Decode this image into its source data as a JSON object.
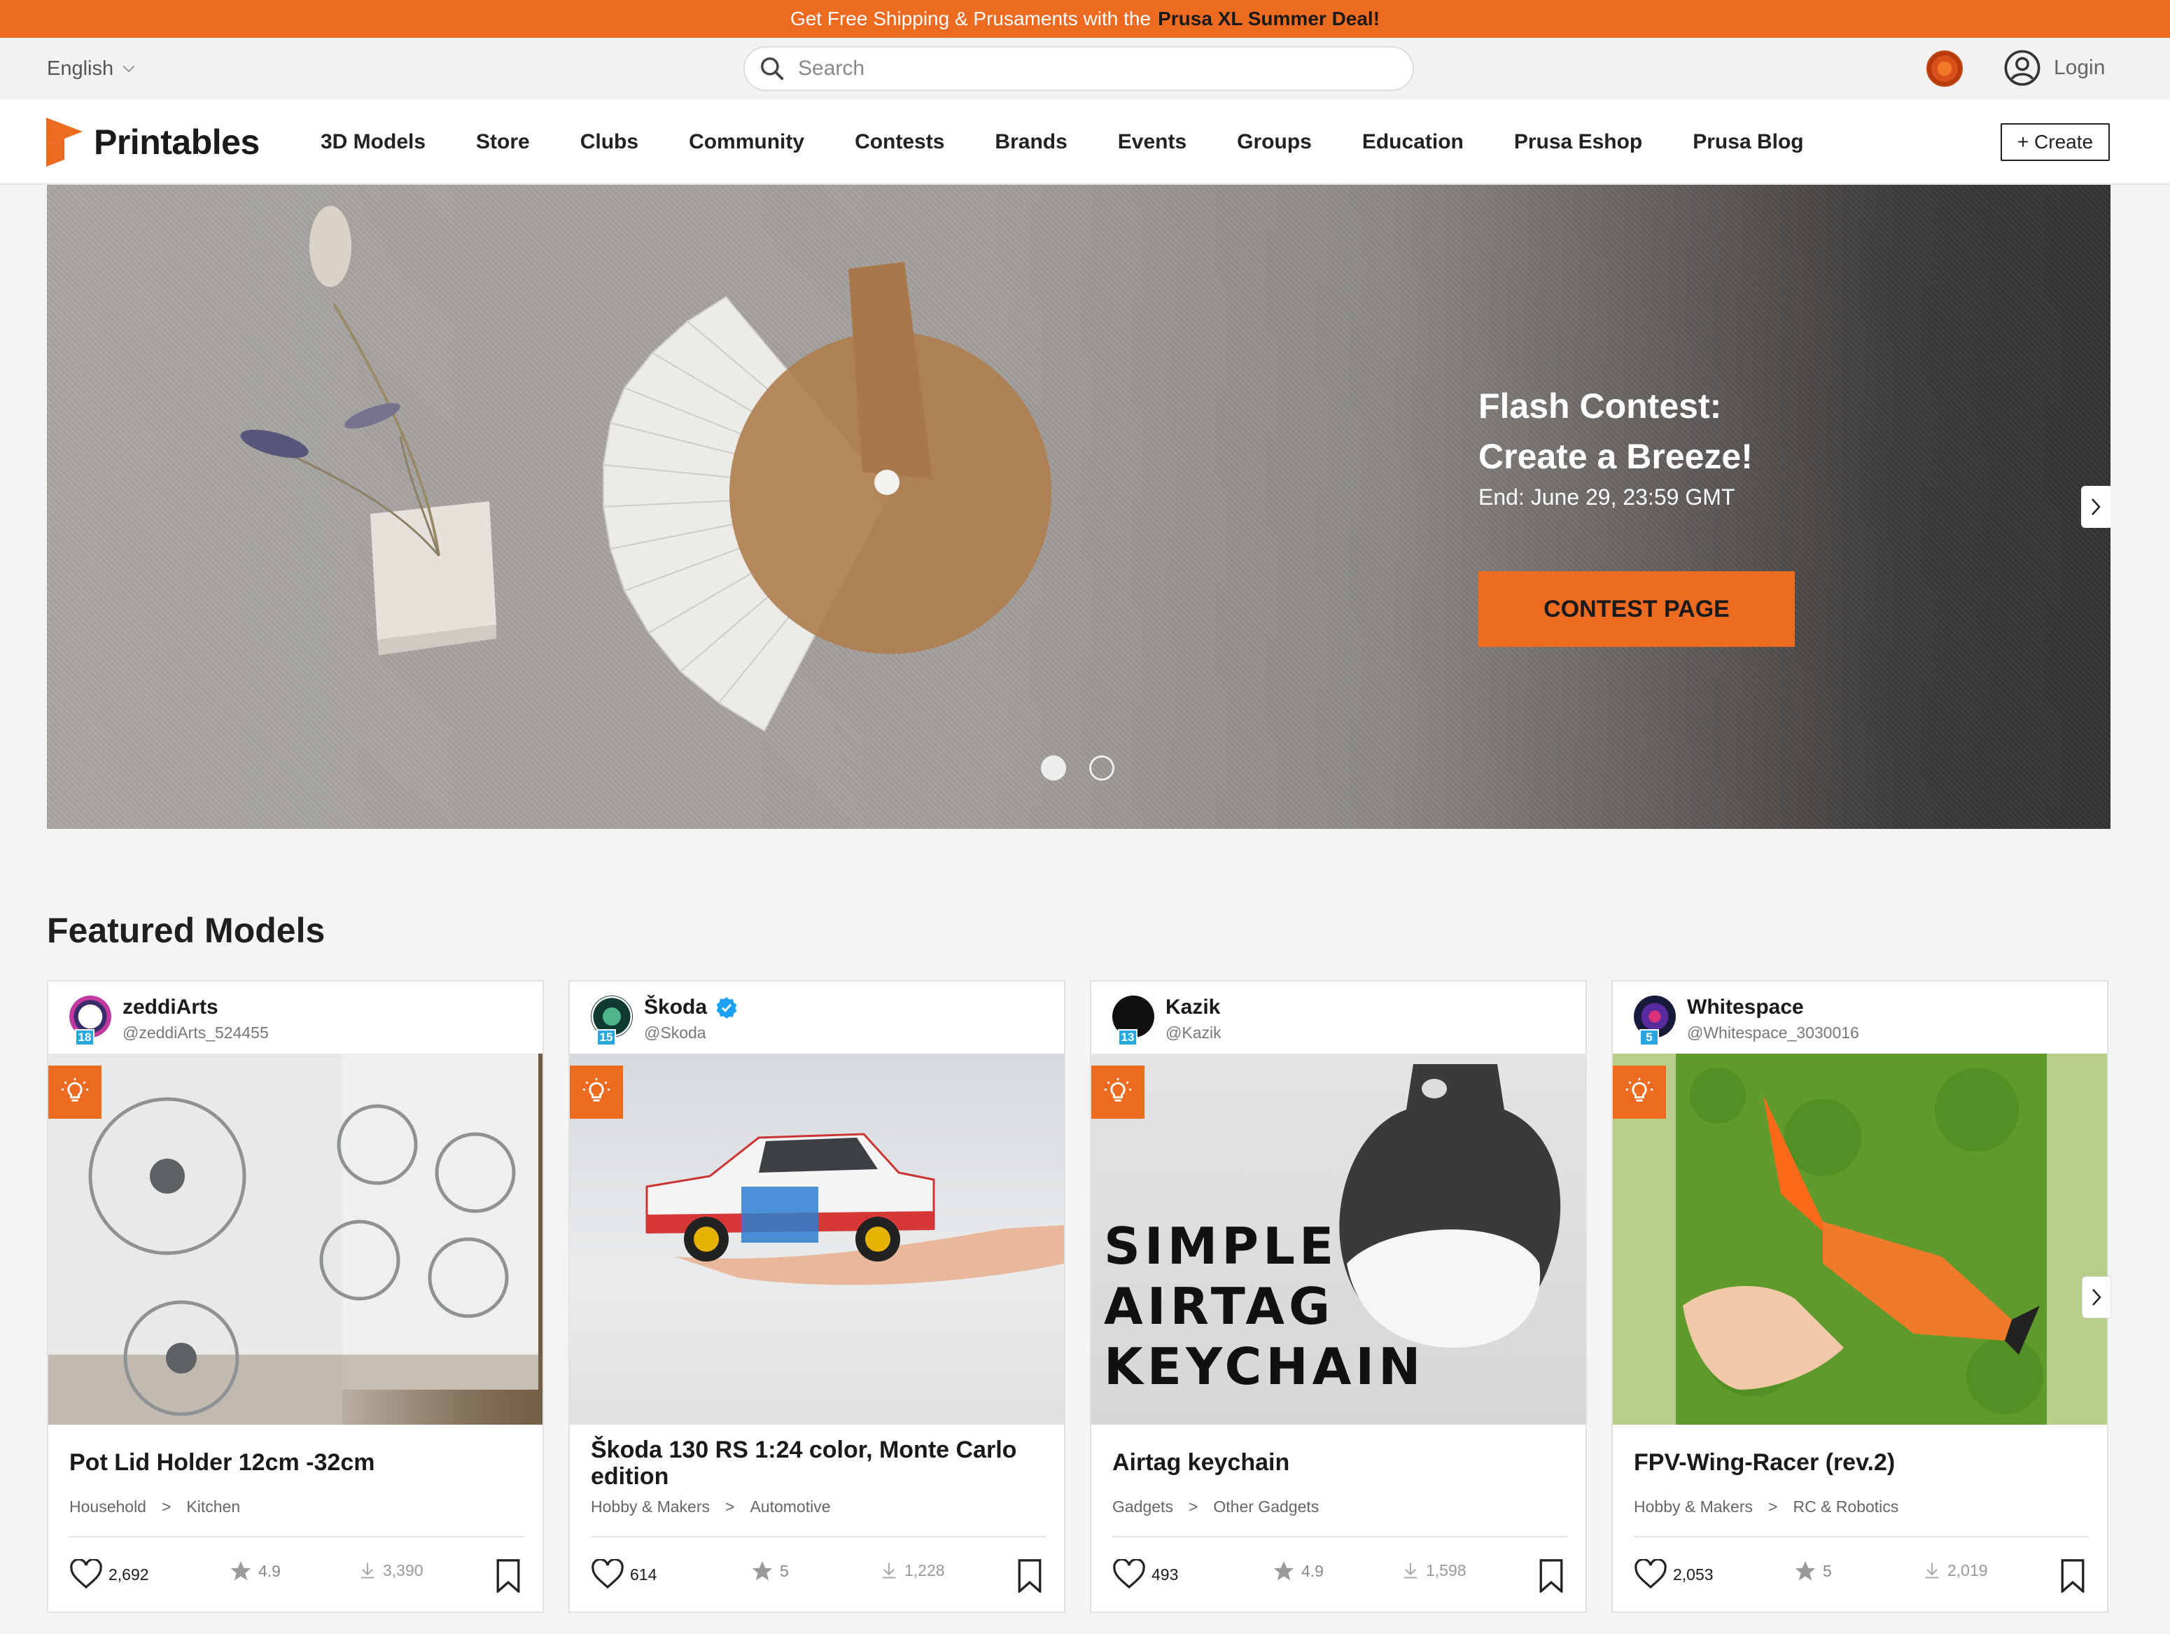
{
  "promo": {
    "text": "Get Free Shipping & Prusaments with the",
    "highlight": "Prusa XL Summer Deal!"
  },
  "utility": {
    "language": "English",
    "search_placeholder": "Search",
    "login_label": "Login"
  },
  "nav": {
    "brand": "Printables",
    "links": [
      "3D Models",
      "Store",
      "Clubs",
      "Community",
      "Contests",
      "Brands",
      "Events",
      "Groups",
      "Education",
      "Prusa Eshop",
      "Prusa Blog"
    ],
    "create_label": "+ Create"
  },
  "hero": {
    "title_line1": "Flash Contest:",
    "title_line2": "Create a Breeze!",
    "subtitle": "End: June 29, 23:59 GMT",
    "cta": "CONTEST PAGE",
    "slides": 2,
    "active_slide": 1
  },
  "featured": {
    "title": "Featured Models",
    "cards": [
      {
        "user": "zeddiArts",
        "handle": "@zeddiArts_524455",
        "level": "18",
        "verified": false,
        "title": "Pot Lid Holder 12cm -32cm",
        "category": "Household",
        "subcategory": "Kitchen",
        "likes": "2,692",
        "rating": "4.9",
        "downloads": "3,390"
      },
      {
        "user": "Škoda",
        "handle": "@Skoda",
        "level": "15",
        "verified": true,
        "title": "Škoda 130 RS 1:24 color, Monte Carlo edition",
        "category": "Hobby & Makers",
        "subcategory": "Automotive",
        "likes": "614",
        "rating": "5",
        "downloads": "1,228"
      },
      {
        "user": "Kazik",
        "handle": "@Kazik",
        "level": "13",
        "verified": false,
        "title": "Airtag keychain",
        "category": "Gadgets",
        "subcategory": "Other Gadgets",
        "likes": "493",
        "rating": "4.9",
        "downloads": "1,598",
        "image_text": [
          "SIMPLE",
          "AIRTAG",
          "KEYCHAIN"
        ]
      },
      {
        "user": "Whitespace",
        "handle": "@Whitespace_3030016",
        "level": "5",
        "verified": false,
        "title": "FPV-Wing-Racer (rev.2)",
        "category": "Hobby & Makers",
        "subcategory": "RC & Robotics",
        "likes": "2,053",
        "rating": "5",
        "downloads": "2,019"
      }
    ]
  },
  "colors": {
    "accent": "#ed6b21",
    "level_badge": "#29a8e0"
  },
  "icons": [
    "search-icon",
    "user-icon",
    "flag-icon",
    "chevron-down-icon",
    "printables-logo-icon",
    "chevron-right-icon",
    "lightbulb-icon",
    "heart-icon",
    "star-icon",
    "download-icon",
    "bookmark-icon",
    "verified-icon"
  ]
}
